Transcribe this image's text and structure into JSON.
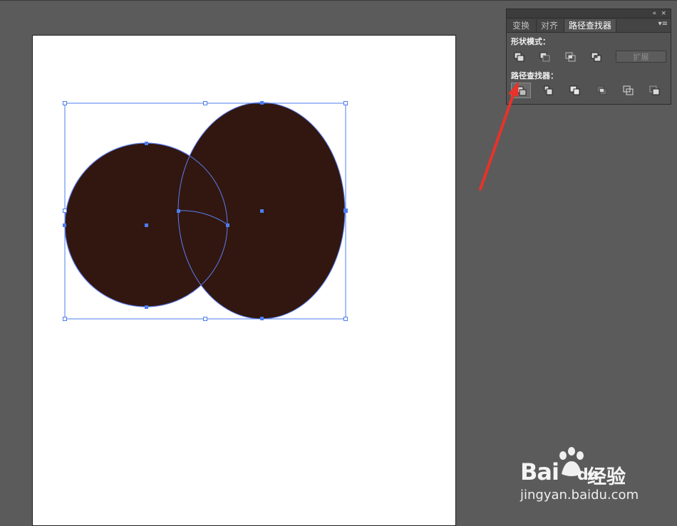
{
  "panel": {
    "tabs": [
      {
        "label": "变换"
      },
      {
        "label": "对齐"
      },
      {
        "label": "路径查找器"
      }
    ],
    "shape_modes_label": "形状模式：",
    "expand_label": "扩展",
    "pathfinders_label": "路径查找器：",
    "collapse_icon": "«",
    "close_icon": "×",
    "menu_icon": "▾≡"
  },
  "artwork": {
    "fill_color": "#311710",
    "selection_color": "#4c7df0"
  },
  "annotation": {
    "arrow_color": "#e8322a"
  },
  "watermark": {
    "logo": "Bai du",
    "logo_part1": "Bai",
    "logo_part2": "du",
    "brand": "经验",
    "url": "jingyan.baidu.com"
  }
}
